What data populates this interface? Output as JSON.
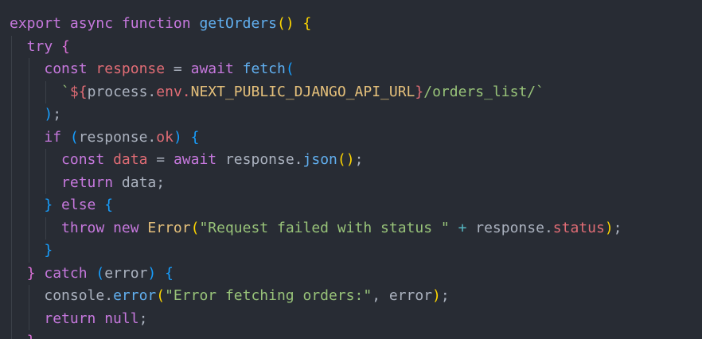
{
  "editor": {
    "lines": [
      {
        "indent": 0,
        "tokens": [
          {
            "t": "export ",
            "c": "kw"
          },
          {
            "t": "async ",
            "c": "kw"
          },
          {
            "t": "function ",
            "c": "kw"
          },
          {
            "t": "getOrders",
            "c": "fn"
          },
          {
            "t": "()",
            "c": "b1"
          },
          {
            "t": " ",
            "c": "txt"
          },
          {
            "t": "{",
            "c": "b1"
          }
        ]
      },
      {
        "indent": 1,
        "tokens": [
          {
            "t": "try ",
            "c": "kw"
          },
          {
            "t": "{",
            "c": "b2"
          }
        ]
      },
      {
        "indent": 2,
        "tokens": [
          {
            "t": "const ",
            "c": "kw"
          },
          {
            "t": "response",
            "c": "var"
          },
          {
            "t": " = ",
            "c": "txt"
          },
          {
            "t": "await ",
            "c": "kw"
          },
          {
            "t": "fetch",
            "c": "fn"
          },
          {
            "t": "(",
            "c": "b3"
          }
        ]
      },
      {
        "indent": 3,
        "tokens": [
          {
            "t": "`",
            "c": "str"
          },
          {
            "t": "${",
            "c": "var"
          },
          {
            "t": "process.",
            "c": "txt"
          },
          {
            "t": "env.",
            "c": "var"
          },
          {
            "t": "NEXT_PUBLIC_DJANGO_API_URL",
            "c": "cls"
          },
          {
            "t": "}",
            "c": "var"
          },
          {
            "t": "/orders_list/`",
            "c": "str"
          }
        ]
      },
      {
        "indent": 2,
        "tokens": [
          {
            "t": ")",
            "c": "b3"
          },
          {
            "t": ";",
            "c": "txt"
          }
        ]
      },
      {
        "indent": 2,
        "tokens": [
          {
            "t": "if ",
            "c": "kw"
          },
          {
            "t": "(",
            "c": "b3"
          },
          {
            "t": "response.",
            "c": "txt"
          },
          {
            "t": "ok",
            "c": "var"
          },
          {
            "t": ")",
            "c": "b3"
          },
          {
            "t": " ",
            "c": "txt"
          },
          {
            "t": "{",
            "c": "b3"
          }
        ]
      },
      {
        "indent": 3,
        "tokens": [
          {
            "t": "const ",
            "c": "kw"
          },
          {
            "t": "data",
            "c": "var"
          },
          {
            "t": " = ",
            "c": "txt"
          },
          {
            "t": "await ",
            "c": "kw"
          },
          {
            "t": "response.",
            "c": "txt"
          },
          {
            "t": "json",
            "c": "fn"
          },
          {
            "t": "()",
            "c": "b1"
          },
          {
            "t": ";",
            "c": "txt"
          }
        ]
      },
      {
        "indent": 3,
        "tokens": [
          {
            "t": "return ",
            "c": "kw"
          },
          {
            "t": "data;",
            "c": "txt"
          }
        ]
      },
      {
        "indent": 2,
        "tokens": [
          {
            "t": "}",
            "c": "b3"
          },
          {
            "t": " ",
            "c": "txt"
          },
          {
            "t": "else ",
            "c": "kw"
          },
          {
            "t": "{",
            "c": "b3"
          }
        ]
      },
      {
        "indent": 3,
        "tokens": [
          {
            "t": "throw ",
            "c": "kw"
          },
          {
            "t": "new ",
            "c": "kw"
          },
          {
            "t": "Error",
            "c": "cls"
          },
          {
            "t": "(",
            "c": "b1"
          },
          {
            "t": "\"Request failed with status \"",
            "c": "str"
          },
          {
            "t": " + ",
            "c": "op"
          },
          {
            "t": "response.",
            "c": "txt"
          },
          {
            "t": "status",
            "c": "var"
          },
          {
            "t": ")",
            "c": "b1"
          },
          {
            "t": ";",
            "c": "txt"
          }
        ]
      },
      {
        "indent": 2,
        "tokens": [
          {
            "t": "}",
            "c": "b3"
          }
        ]
      },
      {
        "indent": 1,
        "tokens": [
          {
            "t": "}",
            "c": "b2"
          },
          {
            "t": " ",
            "c": "txt"
          },
          {
            "t": "catch ",
            "c": "kw"
          },
          {
            "t": "(",
            "c": "b3"
          },
          {
            "t": "error",
            "c": "txt"
          },
          {
            "t": ")",
            "c": "b3"
          },
          {
            "t": " ",
            "c": "txt"
          },
          {
            "t": "{",
            "c": "b3"
          }
        ]
      },
      {
        "indent": 2,
        "tokens": [
          {
            "t": "console.",
            "c": "txt"
          },
          {
            "t": "error",
            "c": "fn"
          },
          {
            "t": "(",
            "c": "b1"
          },
          {
            "t": "\"Error fetching orders:\"",
            "c": "str"
          },
          {
            "t": ", error",
            "c": "txt"
          },
          {
            "t": ")",
            "c": "b1"
          },
          {
            "t": ";",
            "c": "txt"
          }
        ]
      },
      {
        "indent": 2,
        "tokens": [
          {
            "t": "return ",
            "c": "kw"
          },
          {
            "t": "null",
            "c": "kw"
          },
          {
            "t": ";",
            "c": "txt"
          }
        ]
      },
      {
        "indent": 1,
        "tokens": [
          {
            "t": "}",
            "c": "b2"
          }
        ]
      }
    ]
  },
  "theme": {
    "background": "#282c34",
    "keyword": "#c678dd",
    "function": "#61afef",
    "variable": "#e06c75",
    "string": "#98c379",
    "class": "#e5c07b",
    "text": "#abb2bf"
  }
}
